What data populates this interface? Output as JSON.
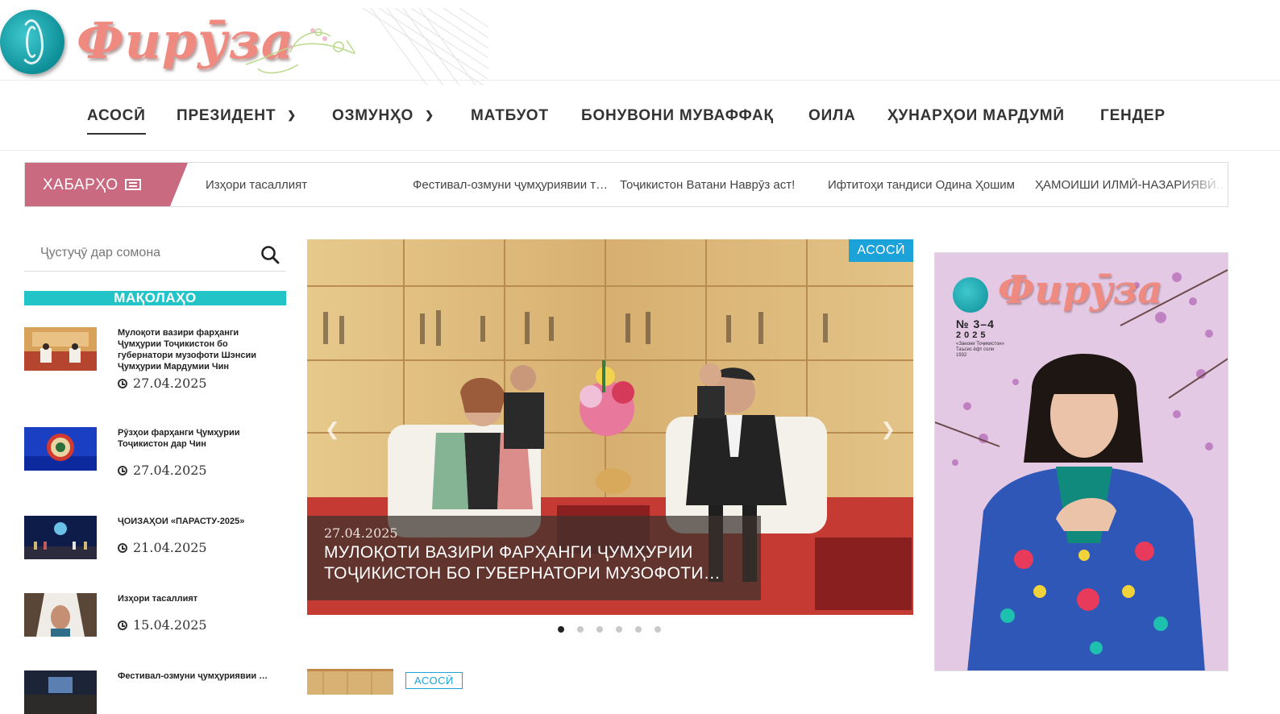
{
  "brand": {
    "logo_text": "Фирӯза"
  },
  "nav": {
    "items": [
      {
        "label": "АСОСӢ",
        "has_dropdown": false,
        "active": true
      },
      {
        "label": "ПРЕЗИДЕНТ",
        "has_dropdown": true,
        "active": false
      },
      {
        "label": "ОЗМУНҲО",
        "has_dropdown": true,
        "active": false
      },
      {
        "label": "МАТБУОТ",
        "has_dropdown": false,
        "active": false
      },
      {
        "label": "БОНУВОНИ МУВАФФАҚ",
        "has_dropdown": false,
        "active": false
      },
      {
        "label": "ОИЛА",
        "has_dropdown": false,
        "active": false
      },
      {
        "label": "ҲУНАРҲОИ МАРДУМӢ",
        "has_dropdown": false,
        "active": false
      },
      {
        "label": "ГЕНДЕР",
        "has_dropdown": false,
        "active": false
      }
    ]
  },
  "ticker": {
    "label": "ХАБАРҲО",
    "icon": "newspaper-icon",
    "items": [
      "Изҳори тасаллият",
      "Фестивал-озмуни ҷумҳуриявии т…",
      "Тоҷикистон Ватани Наврӯз аст!",
      "Ифтитоҳи тандиси Одина Ҳошим",
      "ҲАМОИШИ ИЛМӢ-НАЗАРИЯВӢ…"
    ]
  },
  "search": {
    "placeholder": "Ҷустуҷӯ дар сомона",
    "icon": "search-icon"
  },
  "sidebar": {
    "section_title": "МАҚОЛАҲО",
    "articles": [
      {
        "title": "Мулоқоти вазири фарҳанги Ҷумҳурии Тоҷикистон бо губернатори музофоти Шэнсии Ҷумҳурии Мардумии Чин",
        "date": "27.04.2025"
      },
      {
        "title": "Рӯзҳои фарҳанги Ҷумҳурии Тоҷикистон дар Чин",
        "date": "27.04.2025"
      },
      {
        "title": "ҶОИЗАҲОИ «ПАРАСТУ-2025»",
        "date": "21.04.2025"
      },
      {
        "title": "Изҳори тасаллият",
        "date": "15.04.2025"
      },
      {
        "title": "Фестивал-озмуни ҷумҳуриявии …",
        "date": ""
      }
    ]
  },
  "slider": {
    "tag": "АСОСӢ",
    "date": "27.04.2025",
    "title": "МУЛОҚОТИ ВАЗИРИ ФАРҲАНГИ ҶУМҲУРИИ ТОҶИКИСТОН БО ГУБЕРНАТОРИ МУЗОФОТИ…",
    "dots": 6,
    "active_dot": 0
  },
  "lower": {
    "tag": "АСОСӢ"
  },
  "cover": {
    "title": "Фирӯза",
    "issue": "№ 3–4",
    "year": "2025",
    "subtitle": "«Занони Тоҷикистон» Таъсис ёфт соли 1932"
  },
  "colors": {
    "ticker_label": "#c96a80",
    "section_bar": "#22c4c7",
    "tag_blue": "#1ba2d9",
    "logo_pink": "#ef8a80",
    "logo_teal": "#0e8f98"
  }
}
